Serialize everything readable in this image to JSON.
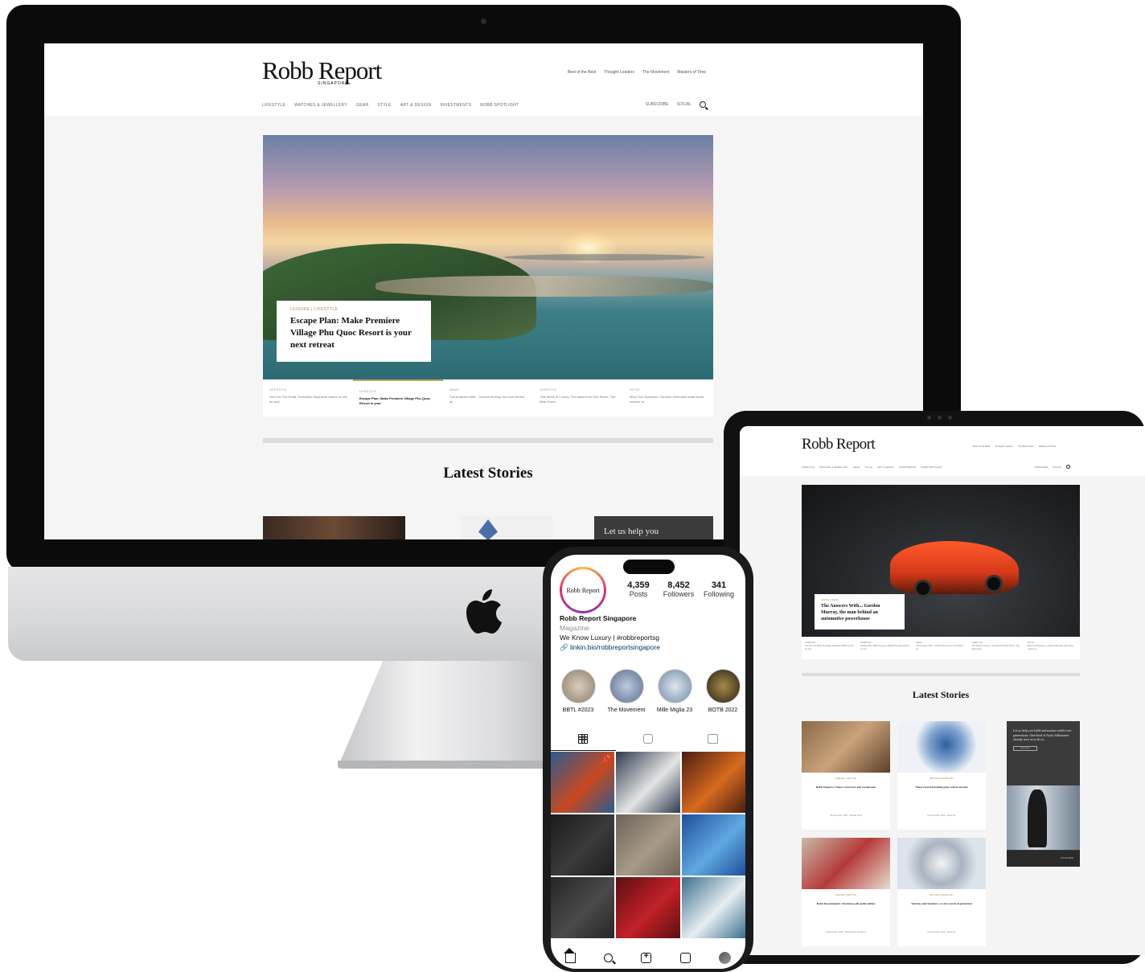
{
  "desktop": {
    "site": {
      "logo": "Robb Report",
      "logo_sub": "SINGAPORE",
      "top_links": [
        "Best of the Best",
        "Thought Leaders",
        "The Movement",
        "Masters of Time"
      ],
      "nav": [
        "LIFESTYLE",
        "WATCHES & JEWELLERY",
        "GEAR",
        "STYLE",
        "ART & DESIGN",
        "INVESTMENTS",
        "ROBB SPOTLIGHT"
      ],
      "nav_right": [
        "SUBSCRIBE",
        "SOCIAL"
      ]
    },
    "hero": {
      "category": "LEISURE | LIFESTYLE",
      "title": "Escape Plan: Make Premiere Village Phu Quoc Resort is your next retreat"
    },
    "strip": [
      {
        "category": "LIFESTYLE",
        "text": "One For The Road: Teetotaler Stephanie Dolton on the art and"
      },
      {
        "category": "LIFESTYLE",
        "text": "Escape Plan: Make Premiere Village Phu Quoc Resort is your"
      },
      {
        "category": "GEAR",
        "text": "The Answers With... Gordon Murray, the man behind an"
      },
      {
        "category": "LIFESTYLE",
        "text": "This Week In Luxury: The latest from Dior Rome, The Mesi Grant,"
      },
      {
        "category": "STYLE",
        "text": "Mind Your Business: Caroline Scheufele adds haute couture to"
      }
    ],
    "latest_title": "Latest Stories",
    "help_text": "Let us help you"
  },
  "tablet": {
    "logo": "Robb Report",
    "top_links": [
      "Best of the Best",
      "Thought Leaders",
      "The Movement",
      "Masters of Time"
    ],
    "nav": [
      "LIFESTYLE",
      "WATCHES & JEWELLERY",
      "GEAR",
      "STYLE",
      "ART & DESIGN",
      "INVESTMENTS",
      "ROBB SPOTLIGHT"
    ],
    "nav_right": [
      "SUBSCRIBE",
      "SOCIAL"
    ],
    "hero": {
      "category": "AUTOS | GEAR",
      "title": "The Answers With... Gordon Murray, the man behind an automotive powerhouse"
    },
    "strip": [
      {
        "category": "LIFESTYLE",
        "text": "One For The Road: Teetotaler Stephanie Dolton on the art and"
      },
      {
        "category": "LIFESTYLE",
        "text": "Escape Plan: Make Premiere Village Phu Quoc Resort is your"
      },
      {
        "category": "GEAR",
        "text": "The Answers With... Gordon Murray, the man behind an"
      },
      {
        "category": "LIFESTYLE",
        "text": "This Week In Luxury: The latest from Dior Rome, The Mesi Grant"
      },
      {
        "category": "STYLE",
        "text": "Mind Your Business: Caroline Scheufele adds haute couture to"
      }
    ],
    "latest_title": "Latest Stories",
    "cards": [
      {
        "category": "LEISURE | LIFESTYLE",
        "title": "Robb Empress: Tokyo's best bars and restaurants",
        "meta": "23 November, 2022 · Hannah Chua"
      },
      {
        "category": "WATCHES & JEWELLERY",
        "title": "These record-breaking gems sold at auction",
        "meta": "23 November, 2022 · Isabel Tan"
      },
      {
        "category": "LEISURE | LIFESTYLE",
        "title": "Robb Recommends: Christmas gift guide edition",
        "meta": "23 December, 2022 · Robb Report Singapore"
      },
      {
        "category": "WATCHES & JEWELLERY",
        "title": "Watches and Wonders: a wrist-watch of perfection",
        "meta": "22 November, 2022 · Isabel Tan"
      }
    ],
    "ad": {
      "text": "Let us help you build and sustain wealth over generations. One-third of Asia's billionaires already trust us to do so.",
      "button": "Find out more",
      "footer": "Private Bank"
    }
  },
  "phone": {
    "avatar_text": "Robb Report",
    "stats": [
      {
        "value": "4,359",
        "label": "Posts"
      },
      {
        "value": "8,452",
        "label": "Followers"
      },
      {
        "value": "341",
        "label": "Following"
      }
    ],
    "name": "Robb Report Singapore",
    "category": "Magazine",
    "bio": "We Know Luxury | #robbreportsg",
    "link": "🔗 linkin.bio/robbreportsingapore",
    "highlights": [
      {
        "label": "BBTL #2023",
        "color": "#b9a898"
      },
      {
        "label": "The Movement",
        "color": "#7a8fb0"
      },
      {
        "label": "Mille Miglia 23",
        "color": "#8ca3be"
      },
      {
        "label": "BOTB 2022",
        "color": "#3b2f1c"
      }
    ],
    "posts": [
      {
        "color": "#2b5c8f",
        "accent": "#c8481f",
        "pinned": true
      },
      {
        "color": "#2d3a4f",
        "accent": "#e4e4e4",
        "pinned": false
      },
      {
        "color": "#4a1d10",
        "accent": "#d86a1e",
        "pinned": false
      },
      {
        "color": "#1c1c1c",
        "accent": "#3a3a3a",
        "pinned": false
      },
      {
        "color": "#6c6258",
        "accent": "#a79a88",
        "pinned": false
      },
      {
        "color": "#1f4e9c",
        "accent": "#5fa8e0",
        "pinned": false
      },
      {
        "color": "#262626",
        "accent": "#4a4a4a",
        "pinned": false
      },
      {
        "color": "#5b0f12",
        "accent": "#c22128",
        "pinned": false
      },
      {
        "color": "#3a6f8c",
        "accent": "#e8eef2",
        "pinned": false
      }
    ]
  }
}
